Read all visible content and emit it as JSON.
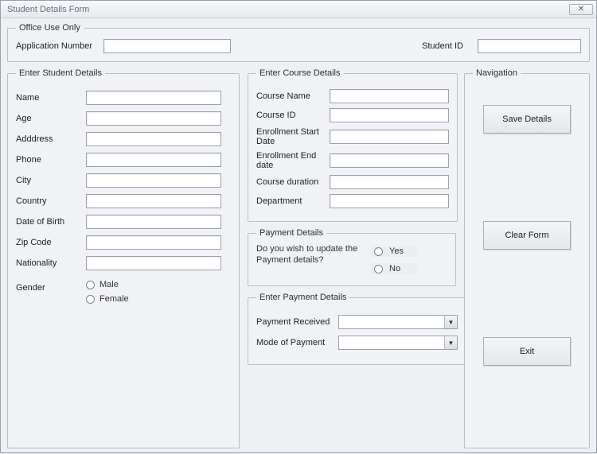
{
  "window": {
    "title": "Student Details Form"
  },
  "office": {
    "legend": "Office Use Only",
    "appnum_label": "Application Number",
    "appnum_value": "",
    "studentid_label": "Student ID",
    "studentid_value": ""
  },
  "student": {
    "legend": "Enter Student Details",
    "fields": {
      "name": {
        "label": "Name",
        "value": ""
      },
      "age": {
        "label": "Age",
        "value": ""
      },
      "address": {
        "label": "Adddress",
        "value": ""
      },
      "phone": {
        "label": "Phone",
        "value": ""
      },
      "city": {
        "label": "City",
        "value": ""
      },
      "country": {
        "label": "Country",
        "value": ""
      },
      "dob": {
        "label": "Date of Birth",
        "value": ""
      },
      "zip": {
        "label": "Zip Code",
        "value": ""
      },
      "nationality": {
        "label": "Nationality",
        "value": ""
      }
    },
    "gender": {
      "label": "Gender",
      "options": {
        "male": "Male",
        "female": "Female"
      }
    }
  },
  "course": {
    "legend": "Enter Course Details",
    "fields": {
      "cname": {
        "label": "Course Name",
        "value": ""
      },
      "cid": {
        "label": "Course ID",
        "value": ""
      },
      "estart": {
        "label": "Enrollment Start Date",
        "value": ""
      },
      "eend": {
        "label": "Enrollment End date",
        "value": ""
      },
      "duration": {
        "label": "Course duration",
        "value": ""
      },
      "dept": {
        "label": "Department",
        "value": ""
      }
    }
  },
  "paymentQuestion": {
    "legend": "Payment Details",
    "question": "Do you wish to update the Payment details?",
    "yes": "Yes",
    "no": "No"
  },
  "paymentEnter": {
    "legend": "Enter Payment Details",
    "received_label": "Payment Received",
    "received_value": "",
    "mode_label": "Mode of Payment",
    "mode_value": ""
  },
  "nav": {
    "legend": "Navigation",
    "save": "Save Details",
    "clear": "Clear Form",
    "exit": "Exit"
  }
}
